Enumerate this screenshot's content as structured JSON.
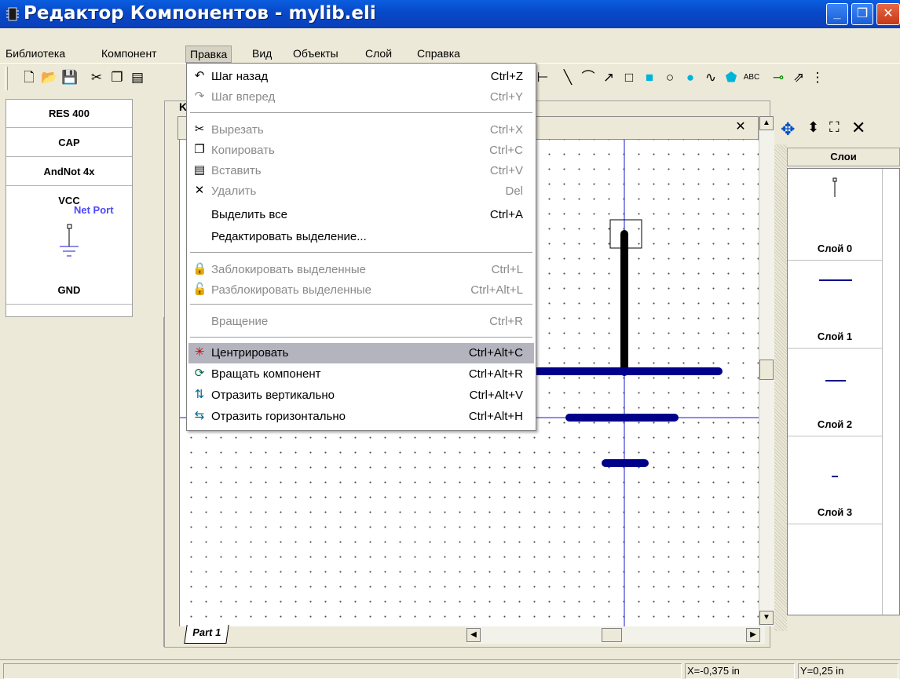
{
  "window": {
    "title": "Редактор Компонентов - mylib.eli"
  },
  "menubar": [
    "Библиотека",
    "Компонент",
    "Правка",
    "Вид",
    "Объекты",
    "Слой",
    "Справка"
  ],
  "open_menu_index": 2,
  "components": [
    {
      "name": "RES 400"
    },
    {
      "name": "CAP"
    },
    {
      "name": "AndNot 4x"
    },
    {
      "name": "VCC"
    },
    {
      "name": "GND"
    }
  ],
  "net_port_label": "Net Port",
  "editor_tab": "K",
  "part_tab": "Part 1",
  "layers": {
    "header": "Слои",
    "items": [
      "Слой 0",
      "Слой 1",
      "Слой 2",
      "Слой 3"
    ]
  },
  "status": {
    "x": "X=-0,375 in",
    "y": "Y=0,25 in"
  },
  "dropdown": [
    {
      "label": "Шаг назад",
      "shortcut": "Ctrl+Z",
      "icon": "undo-icon",
      "glyph": "↶",
      "enabled": true
    },
    {
      "label": "Шаг вперед",
      "shortcut": "Ctrl+Y",
      "icon": "redo-icon",
      "glyph": "↷",
      "enabled": false
    },
    {
      "label": "Вырезать",
      "shortcut": "Ctrl+X",
      "icon": "scissors-icon",
      "glyph": "✂",
      "enabled": false
    },
    {
      "label": "Копировать",
      "shortcut": "Ctrl+C",
      "icon": "copy-icon",
      "glyph": "❐",
      "enabled": false
    },
    {
      "label": "Вставить",
      "shortcut": "Ctrl+V",
      "icon": "paste-icon",
      "glyph": "▤",
      "enabled": false
    },
    {
      "label": "Удалить",
      "shortcut": "Del",
      "icon": "delete-icon",
      "glyph": "✕",
      "enabled": false
    },
    {
      "label": "Выделить все",
      "shortcut": "Ctrl+A",
      "icon": "",
      "glyph": "",
      "enabled": true
    },
    {
      "label": "Редактировать выделение...",
      "shortcut": "",
      "icon": "",
      "glyph": "",
      "enabled": true
    },
    {
      "label": "Заблокировать выделенные",
      "shortcut": "Ctrl+L",
      "icon": "lock-icon",
      "glyph": "🔒",
      "enabled": false
    },
    {
      "label": "Разблокировать выделенные",
      "shortcut": "Ctrl+Alt+L",
      "icon": "unlock-icon",
      "glyph": "🔓",
      "enabled": false
    },
    {
      "label": "Вращение",
      "shortcut": "Ctrl+R",
      "icon": "",
      "glyph": "",
      "enabled": false
    },
    {
      "label": "Центрировать",
      "shortcut": "Ctrl+Alt+C",
      "icon": "center-icon",
      "glyph": "✳",
      "enabled": true
    },
    {
      "label": "Вращать компонент",
      "shortcut": "Ctrl+Alt+R",
      "icon": "rotate-icon",
      "glyph": "⟳",
      "enabled": true
    },
    {
      "label": "Отразить вертикально",
      "shortcut": "Ctrl+Alt+V",
      "icon": "flip-vertical-icon",
      "glyph": "⇅",
      "enabled": true
    },
    {
      "label": "Отразить горизонтально",
      "shortcut": "Ctrl+Alt+H",
      "icon": "flip-horizontal-icon",
      "glyph": "⇆",
      "enabled": true
    }
  ],
  "colors": {
    "titlebar": "#0848c8",
    "wire": "#00008b",
    "grid_line": "#1a1acc",
    "highlight": "#b4b4bf"
  }
}
